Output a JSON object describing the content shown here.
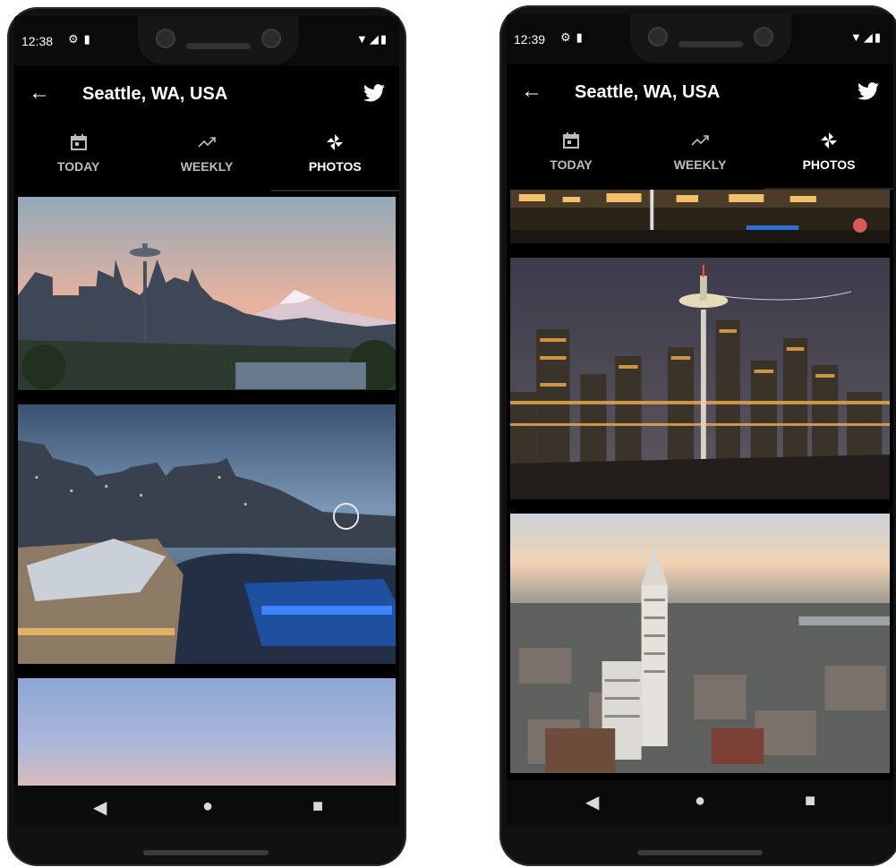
{
  "phones": [
    {
      "time": "12:38",
      "title": "Seattle, WA, USA",
      "tabs": [
        {
          "label": "TODAY",
          "icon": "calendar-icon"
        },
        {
          "label": "WEEKLY",
          "icon": "trending-up-icon"
        },
        {
          "label": "PHOTOS",
          "icon": "pinwheel-icon",
          "active": true
        }
      ],
      "photos": [
        "space-needle-mt-rainier-sunset",
        "waterfront-ferris-wheel-dusk",
        "twilight-sky"
      ]
    },
    {
      "time": "12:39",
      "title": "Seattle, WA, USA",
      "tabs": [
        {
          "label": "TODAY",
          "icon": "calendar-icon"
        },
        {
          "label": "WEEKLY",
          "icon": "trending-up-icon"
        },
        {
          "label": "PHOTOS",
          "icon": "pinwheel-icon",
          "active": true
        }
      ],
      "photos": [
        "street-night-lights",
        "space-needle-night-skyline",
        "smith-tower-aerial"
      ]
    }
  ],
  "colors": {
    "background": "#000000",
    "text": "#ffffff",
    "inactive_tab": "#bdbdbd"
  }
}
